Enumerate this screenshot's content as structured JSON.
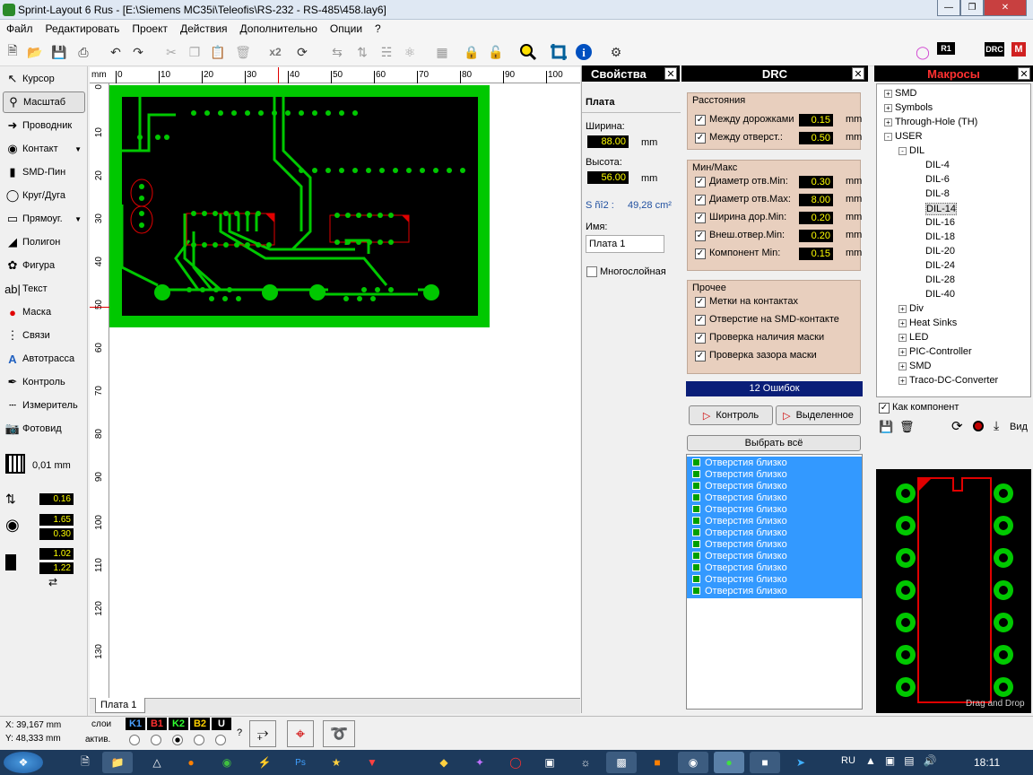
{
  "window": {
    "title": "Sprint-Layout 6 Rus - [E:\\Siemens MC35i\\Teleofis\\RS-232 - RS-485\\458.lay6]"
  },
  "menu": [
    "Файл",
    "Редактировать",
    "Проект",
    "Действия",
    "Дополнительно",
    "Опции",
    "?"
  ],
  "toolbar": {
    "x2_label": "x2",
    "r1_label": "R1",
    "drc_label": "DRC",
    "m_label": "M"
  },
  "tools": [
    {
      "label": "Курсор",
      "icon": "cursor-icon"
    },
    {
      "label": "Масштаб",
      "icon": "zoom-icon"
    },
    {
      "label": "Проводник",
      "icon": "track-icon"
    },
    {
      "label": "Контакт",
      "icon": "pad-icon"
    },
    {
      "label": "SMD-Пин",
      "icon": "smd-icon"
    },
    {
      "label": "Круг/Дуга",
      "icon": "circle-icon"
    },
    {
      "label": "Прямоуг.",
      "icon": "rect-icon"
    },
    {
      "label": "Полигон",
      "icon": "polygon-icon"
    },
    {
      "label": "Фигура",
      "icon": "figure-icon"
    },
    {
      "label": "Текст",
      "icon": "text-icon"
    },
    {
      "label": "Маска",
      "icon": "mask-icon"
    },
    {
      "label": "Связи",
      "icon": "connections-icon"
    },
    {
      "label": "Автотрасса",
      "icon": "autoroute-icon"
    },
    {
      "label": "Контроль",
      "icon": "test-icon"
    },
    {
      "label": "Измеритель",
      "icon": "measure-icon"
    },
    {
      "label": "Фотовид",
      "icon": "photo-icon"
    }
  ],
  "grid": {
    "value": "0,01 mm"
  },
  "params": {
    "track_width": "0.16",
    "pad_outer": "1.65",
    "pad_inner": "0.30",
    "smd_w": "1.02",
    "smd_h": "1.22"
  },
  "ruler": {
    "unit": "mm",
    "top": [
      "0",
      "10",
      "20",
      "30",
      "40",
      "50",
      "60",
      "70",
      "80",
      "90",
      "100"
    ],
    "left": [
      "0",
      "10",
      "20",
      "30",
      "40",
      "50",
      "60",
      "70",
      "80",
      "90",
      "100",
      "110",
      "120",
      "130"
    ]
  },
  "sheet_tab": "Плата 1",
  "props": {
    "title": "Свойства",
    "section": "Плата",
    "width_label": "Ширина:",
    "width": "88.00",
    "height_label": "Высота:",
    "height": "56.00",
    "unit": "mm",
    "area_label": "S ñî2 :",
    "area": "49,28 cm²",
    "name_label": "Имя:",
    "name": "Плата 1",
    "multilayer": "Многослойная"
  },
  "drc": {
    "title": "DRC",
    "distances_title": "Расстояния",
    "distances": [
      {
        "label": "Между дорожками",
        "value": "0.15"
      },
      {
        "label": "Между отверст.:",
        "value": "0.50"
      }
    ],
    "minmax_title": "Мин/Макс",
    "minmax": [
      {
        "label": "Диаметр отв.Min:",
        "value": "0.30"
      },
      {
        "label": "Диаметр отв.Max:",
        "value": "8.00"
      },
      {
        "label": "Ширина дор.Min:",
        "value": "0.20"
      },
      {
        "label": "Внеш.отвер.Min:",
        "value": "0.20"
      },
      {
        "label": "Компонент Min:",
        "value": "0.15"
      }
    ],
    "unit": "mm",
    "other_title": "Прочее",
    "other": [
      "Метки на контактах",
      "Отверстие на SMD-контакте",
      "Проверка наличия маски",
      "Проверка зазора маски"
    ],
    "errors_count": "12 Ошибок",
    "btn_check": "Контроль",
    "btn_selected": "Выделенное",
    "btn_select_all": "Выбрать всё",
    "errors": [
      "Отверстия близко",
      "Отверстия близко",
      "Отверстия близко",
      "Отверстия близко",
      "Отверстия близко",
      "Отверстия близко",
      "Отверстия близко",
      "Отверстия близко",
      "Отверстия близко",
      "Отверстия близко",
      "Отверстия близко",
      "Отверстия близко"
    ]
  },
  "macros": {
    "title": "Макросы",
    "tree": [
      {
        "label": "SMD",
        "level": 0,
        "sign": "+"
      },
      {
        "label": "Symbols",
        "level": 0,
        "sign": "+"
      },
      {
        "label": "Through-Hole (TH)",
        "level": 0,
        "sign": "+"
      },
      {
        "label": "USER",
        "level": 0,
        "sign": "-"
      },
      {
        "label": "DIL",
        "level": 1,
        "sign": "-"
      },
      {
        "label": "DIL-4",
        "level": 2,
        "sign": ""
      },
      {
        "label": "DIL-6",
        "level": 2,
        "sign": ""
      },
      {
        "label": "DIL-8",
        "level": 2,
        "sign": ""
      },
      {
        "label": "DIL-14",
        "level": 2,
        "sign": ""
      },
      {
        "label": "DIL-16",
        "level": 2,
        "sign": ""
      },
      {
        "label": "DIL-18",
        "level": 2,
        "sign": ""
      },
      {
        "label": "DIL-20",
        "level": 2,
        "sign": ""
      },
      {
        "label": "DIL-24",
        "level": 2,
        "sign": ""
      },
      {
        "label": "DIL-28",
        "level": 2,
        "sign": ""
      },
      {
        "label": "DIL-40",
        "level": 2,
        "sign": ""
      },
      {
        "label": "Div",
        "level": 1,
        "sign": "+"
      },
      {
        "label": "Heat Sinks",
        "level": 1,
        "sign": "+"
      },
      {
        "label": "LED",
        "level": 1,
        "sign": "+"
      },
      {
        "label": "PIC-Controller",
        "level": 1,
        "sign": "+"
      },
      {
        "label": "SMD",
        "level": 1,
        "sign": "+"
      },
      {
        "label": "Traco-DC-Converter",
        "level": 1,
        "sign": "+"
      }
    ],
    "as_component": "Как компонент",
    "view_label": "Вид",
    "drag_drop": "Drag and Drop"
  },
  "status": {
    "x": "X:  39,167 mm",
    "y": "Y:  48,333 mm",
    "layers_label": "слои",
    "active_label": "актив.",
    "layers": [
      {
        "name": "K1",
        "color": "#4aa0ff"
      },
      {
        "name": "B1",
        "color": "#ff3030"
      },
      {
        "name": "K2",
        "color": "#30ff30"
      },
      {
        "name": "B2",
        "color": "#ffd000"
      },
      {
        "name": "U",
        "color": "#ffffff"
      }
    ],
    "question": "?"
  },
  "taskbar": {
    "lang": "RU",
    "time": "18:11"
  }
}
